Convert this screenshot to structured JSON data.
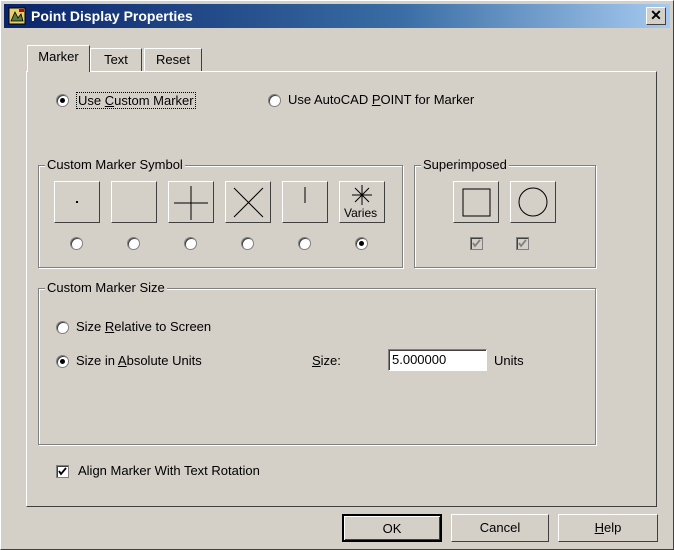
{
  "window": {
    "title": "Point Display Properties",
    "close_label": "✕"
  },
  "tabs": [
    {
      "label": "Marker",
      "active": true
    },
    {
      "label": "Text",
      "active": false
    },
    {
      "label": "Reset",
      "active": false
    }
  ],
  "marker_mode": {
    "custom": {
      "pre": "Use ",
      "mnemonic": "C",
      "post": "ustom Marker",
      "checked": true
    },
    "autocad": {
      "pre": "Use AutoCAD ",
      "mnemonic": "P",
      "post": "OINT for Marker",
      "checked": false
    }
  },
  "symbol_group": {
    "label": "Custom Marker Symbol",
    "symbols": [
      {
        "icon": "dot-icon",
        "selected": false
      },
      {
        "icon": "blank-icon",
        "selected": false
      },
      {
        "icon": "plus-icon",
        "selected": false
      },
      {
        "icon": "cross-icon",
        "selected": false
      },
      {
        "icon": "tick-icon",
        "selected": false
      },
      {
        "icon": "varies-icon",
        "selected": true,
        "caption": "Varies"
      }
    ]
  },
  "superimposed": {
    "label": "Superimposed",
    "items": [
      {
        "icon": "square-icon",
        "checked": true
      },
      {
        "icon": "circle-icon",
        "checked": true
      }
    ]
  },
  "size_group": {
    "label": "Custom Marker Size",
    "relative": {
      "pre": "Size ",
      "mnemonic": "R",
      "post": "elative to Screen",
      "checked": false
    },
    "absolute": {
      "pre": "Size in ",
      "mnemonic": "A",
      "post": "bsolute Units",
      "checked": true
    },
    "size_label": {
      "mnemonic": "S",
      "post": "ize:"
    },
    "size_value": "5.000000",
    "units_label": "Units"
  },
  "align": {
    "label": "Align Marker With Text Rotation",
    "checked": true
  },
  "buttons": {
    "ok": "OK",
    "cancel": "Cancel",
    "help": {
      "mnemonic": "H",
      "post": "elp"
    }
  }
}
